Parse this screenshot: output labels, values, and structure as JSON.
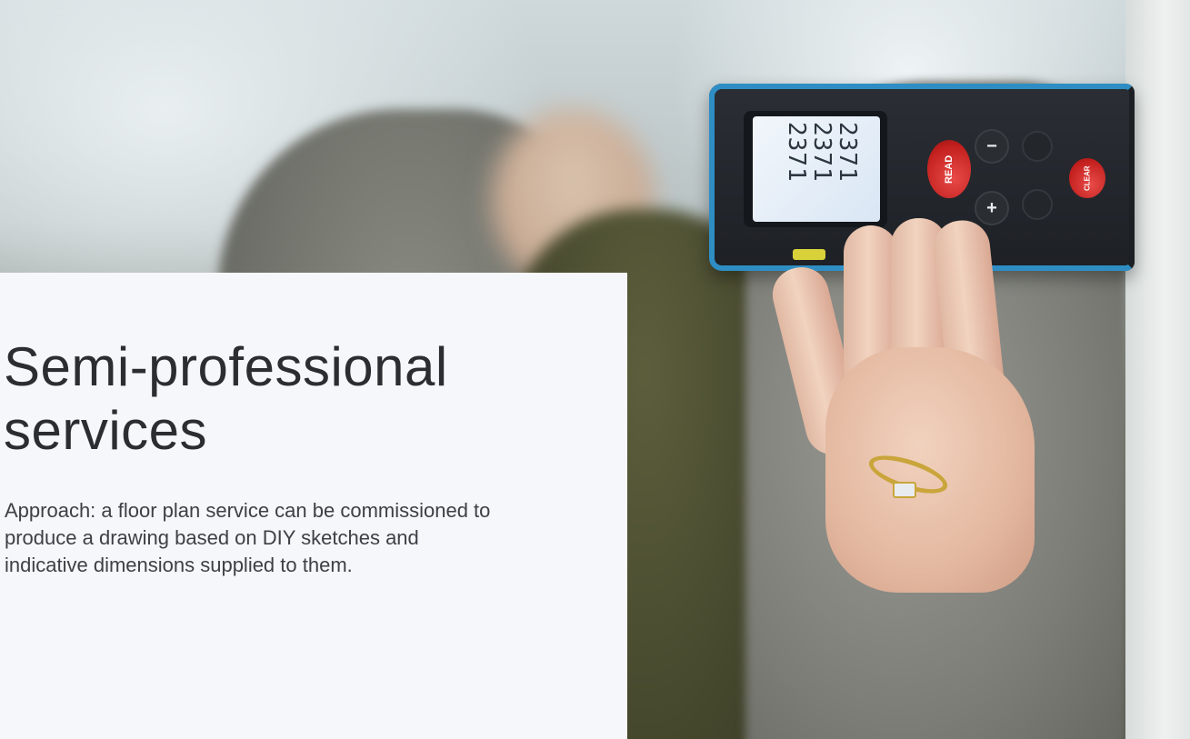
{
  "hero": {
    "image_alt_subject": "",
    "device": {
      "button_read": "READ",
      "button_clear": "CLEAR",
      "button_minus": "−",
      "button_plus": "+",
      "lcd_rows": [
        "2371",
        "2371",
        "2371"
      ]
    }
  },
  "content": {
    "headline_line1": "Semi-professional",
    "headline_line2": "services",
    "description": "Approach: a floor plan service can be commissioned to produce a drawing based on DIY sketches and indicative dimensions supplied to them."
  },
  "colors": {
    "panel_background": "#f5f7fa",
    "headline_text": "#2b2d31",
    "body_text": "#3d4046",
    "device_accent": "#2e8ec4",
    "button_red": "#c21f1d"
  }
}
